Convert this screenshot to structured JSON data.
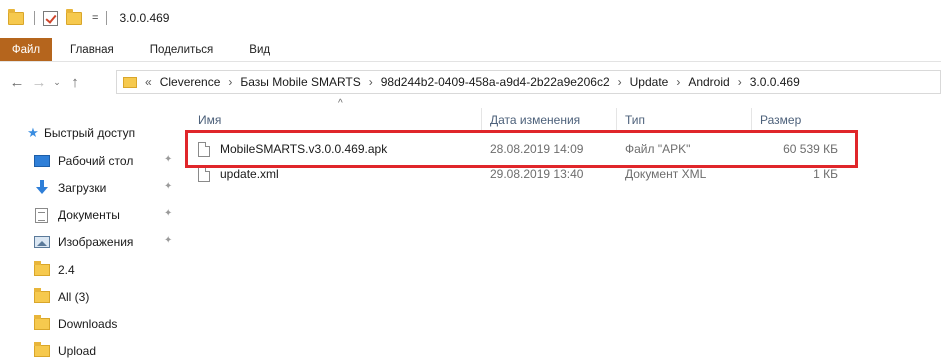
{
  "titlebar": {
    "title": "3.0.0.469",
    "caret": "="
  },
  "ribbon": {
    "file_tab": "Файл",
    "tabs": [
      "Главная",
      "Поделиться",
      "Вид"
    ]
  },
  "nav": {
    "back": "←",
    "forward": "→",
    "recent": "⌄",
    "up": "↑",
    "overflow": "«",
    "breadcrumb": [
      "Cleverence",
      "Базы Mobile SMARTS",
      "98d244b2-0409-458a-a9d4-2b22a9e206c2",
      "Update",
      "Android",
      "3.0.0.469"
    ],
    "separator": "›"
  },
  "sidebar": {
    "quick_access": "Быстрый доступ",
    "items": [
      {
        "label": "Рабочий стол",
        "icon": "desktop-icon",
        "pinned": true
      },
      {
        "label": "Загрузки",
        "icon": "downloads-icon",
        "pinned": true
      },
      {
        "label": "Документы",
        "icon": "documents-icon",
        "pinned": true
      },
      {
        "label": "Изображения",
        "icon": "pictures-icon",
        "pinned": true
      },
      {
        "label": "2.4",
        "icon": "folder-icon",
        "pinned": false
      },
      {
        "label": "All (3)",
        "icon": "folder-icon",
        "pinned": false
      },
      {
        "label": "Downloads",
        "icon": "folder-icon",
        "pinned": false
      },
      {
        "label": "Upload",
        "icon": "folder-icon",
        "pinned": false
      }
    ],
    "pin_glyph": "✦"
  },
  "filelist": {
    "sort_caret": "^",
    "columns": {
      "name": "Имя",
      "date": "Дата изменения",
      "type": "Тип",
      "size": "Размер"
    },
    "rows": [
      {
        "name": "MobileSMARTS.v3.0.0.469.apk",
        "date": "28.08.2019 14:09",
        "type": "Файл \"APK\"",
        "size": "60 539 КБ"
      },
      {
        "name": "update.xml",
        "date": "29.08.2019 13:40",
        "type": "Документ XML",
        "size": "1 КБ"
      }
    ]
  },
  "colors": {
    "highlight": "#e0262a",
    "file_tab": "#b5651d",
    "folder": "#f6c94e",
    "accent": "#2f7fd8"
  }
}
